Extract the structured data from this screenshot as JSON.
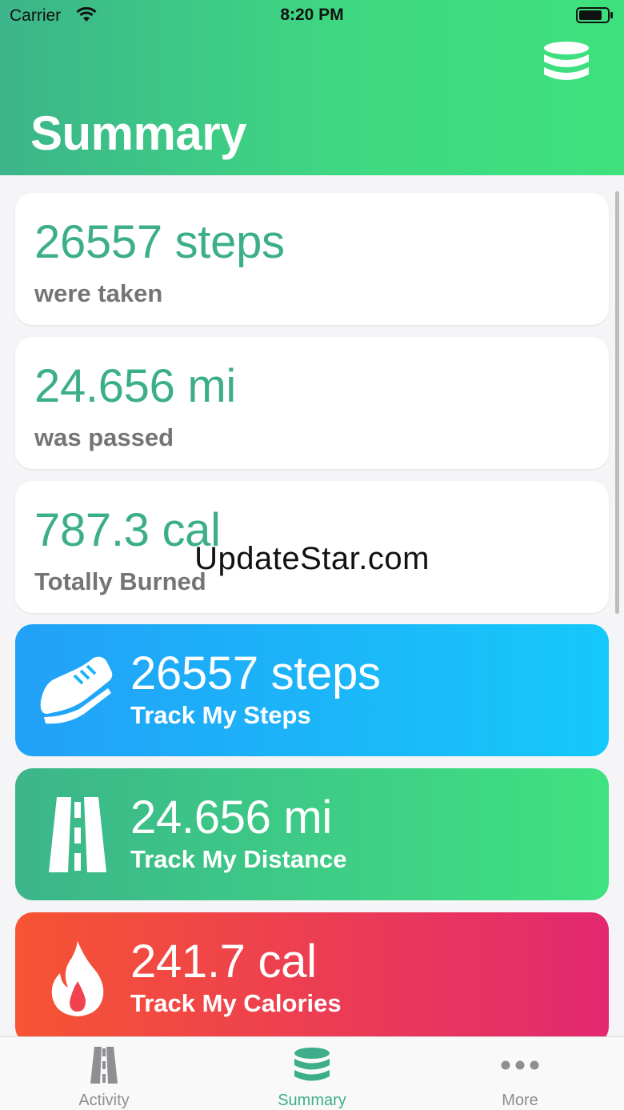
{
  "status_bar": {
    "carrier": "Carrier",
    "time": "8:20 PM"
  },
  "header": {
    "title": "Summary",
    "action_icon": "database-icon"
  },
  "colors": {
    "accent": "#3cae8a",
    "header_gradient": [
      "#3cb58a",
      "#3ee17e"
    ],
    "steps_gradient": [
      "#22a1f7",
      "#16c8fb"
    ],
    "distance_gradient": [
      "#3cb58a",
      "#3fe281"
    ],
    "calories_gradient": [
      "#f65433",
      "#e32870"
    ]
  },
  "summary_cards": [
    {
      "value": "26557 steps",
      "caption": "were taken"
    },
    {
      "value": "24.656 mi",
      "caption": "was passed"
    },
    {
      "value": "787.3 cal",
      "caption": "Totally Burned"
    }
  ],
  "tracker_tiles": [
    {
      "icon": "shoe-icon",
      "value": "26557 steps",
      "label": "Track My Steps"
    },
    {
      "icon": "road-icon",
      "value": "24.656 mi",
      "label": "Track My Distance"
    },
    {
      "icon": "flame-icon",
      "value": "241.7 cal",
      "label": "Track My Calories"
    }
  ],
  "watermark": "UpdateStar.com",
  "tabbar": {
    "selected": "Summary",
    "tabs": [
      {
        "label": "Activity",
        "icon": "road-icon"
      },
      {
        "label": "Summary",
        "icon": "database-icon"
      },
      {
        "label": "More",
        "icon": "more-dots-icon"
      }
    ]
  }
}
